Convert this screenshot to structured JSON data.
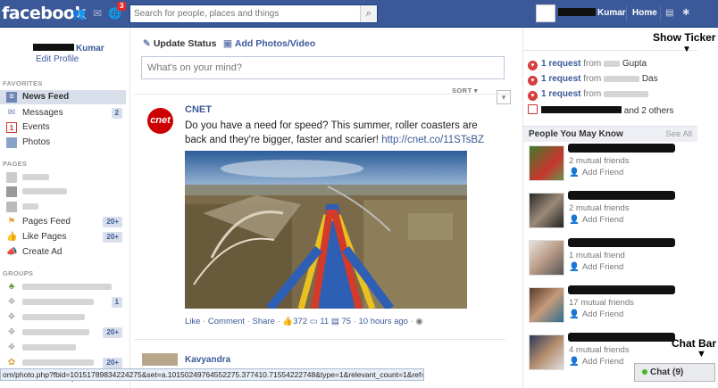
{
  "header": {
    "logo": "facebook",
    "notifications_count": "3",
    "search_placeholder": "Search for people, places and things",
    "user_name": "Kumar",
    "home_label": "Home"
  },
  "left_nav": {
    "profile_name": "Kumar",
    "edit_profile": "Edit Profile",
    "favorites_title": "FAVORITES",
    "favorites": [
      {
        "label": "News Feed",
        "icon": "news-feed-icon",
        "count": ""
      },
      {
        "label": "Messages",
        "icon": "messages-icon",
        "count": "2"
      },
      {
        "label": "Events",
        "icon": "events-icon",
        "count": ""
      },
      {
        "label": "Photos",
        "icon": "photos-icon",
        "count": ""
      }
    ],
    "pages_title": "PAGES",
    "pages": [
      {
        "label": "Pages Feed",
        "count": "20+"
      },
      {
        "label": "Like Pages",
        "count": "20+"
      },
      {
        "label": "Create Ad",
        "count": ""
      }
    ],
    "pages_counts": [
      "20+"
    ],
    "groups_title": "GROUPS",
    "groups_counts": [
      "1",
      "20+",
      "20+"
    ],
    "create_group": "Create Group..."
  },
  "composer": {
    "update_status": "Update Status",
    "add_photos": "Add Photos/Video",
    "placeholder": "What's on your mind?"
  },
  "feed": {
    "sort_label": "SORT",
    "post": {
      "author": "CNET",
      "avatar_text": "cnet",
      "text": "Do you have a need for speed? This summer, roller coasters are back and they're bigger, faster and scarier!",
      "link": "http://cnet.co/11STsBZ",
      "actions": [
        "Like",
        "Comment",
        "Share"
      ],
      "likes": "372",
      "comments": "11",
      "shares": "75",
      "time": "10 hours ago"
    },
    "next_author": "Kavyandra"
  },
  "right_col": {
    "requests": [
      {
        "count": "1 request",
        "from": "from",
        "name": "Gupta"
      },
      {
        "count": "1 request",
        "from": "from",
        "name": "Das"
      },
      {
        "count": "1 request",
        "from": "from",
        "name": ""
      }
    ],
    "others": "and 2 others",
    "pymk_title": "People You May Know",
    "see_all": "See All",
    "people": [
      {
        "mutual": "2 mutual friends",
        "add": "Add Friend"
      },
      {
        "mutual": "2 mutual friends",
        "add": "Add Friend"
      },
      {
        "mutual": "1 mutual friend",
        "add": "Add Friend"
      },
      {
        "mutual": "17 mutual friends",
        "add": "Add Friend"
      },
      {
        "mutual": "4 mutual friends",
        "add": "Add Friend"
      }
    ]
  },
  "annotations": {
    "show_ticker": "Show Ticker",
    "chat_bar": "Chat Bar"
  },
  "chat": {
    "label": "Chat (9)"
  },
  "status_bar": {
    "url": "om/photo.php?fbid=10151789834224275&set=a.10150249764552275.377410.71554222748&type=1&relevant_count=1&ref=nf"
  },
  "colors": {
    "brand_blue": "#3b5998",
    "nav_selected": "#d8dfea",
    "badge_red": "#e02b2b"
  }
}
